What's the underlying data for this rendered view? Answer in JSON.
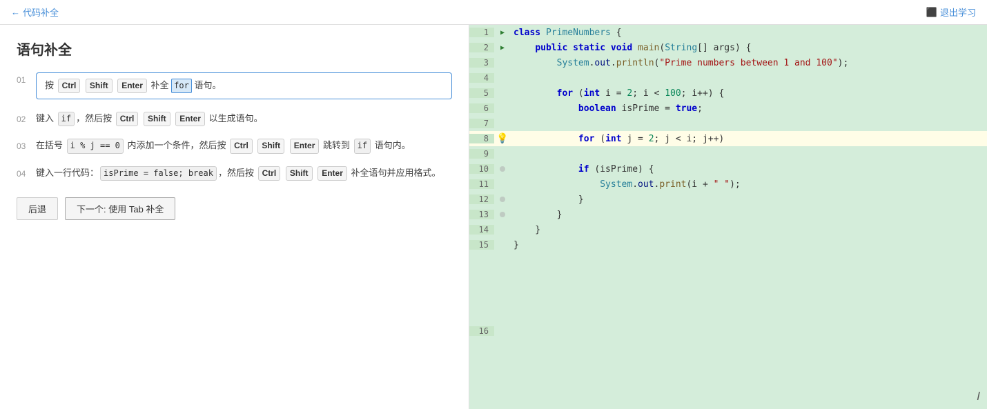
{
  "nav": {
    "back_icon": "←",
    "back_label": "代码补全",
    "exit_icon": "⬛",
    "exit_label": "退出学习"
  },
  "left_panel": {
    "title": "语句补全",
    "steps": [
      {
        "number": "01",
        "active": true,
        "parts": [
          {
            "type": "text",
            "value": "按 "
          },
          {
            "type": "key",
            "value": "Ctrl"
          },
          {
            "type": "text",
            "value": " "
          },
          {
            "type": "key",
            "value": "Shift"
          },
          {
            "type": "text",
            "value": " "
          },
          {
            "type": "key",
            "value": "Enter"
          },
          {
            "type": "text",
            "value": " 补全 "
          },
          {
            "type": "highlight",
            "value": "for"
          },
          {
            "type": "text",
            "value": " 语句。"
          }
        ]
      },
      {
        "number": "02",
        "active": false,
        "parts": [
          {
            "type": "text",
            "value": "键入 "
          },
          {
            "type": "code",
            "value": "if"
          },
          {
            "type": "text",
            "value": "，然后按 "
          },
          {
            "type": "key",
            "value": "Ctrl"
          },
          {
            "type": "text",
            "value": " "
          },
          {
            "type": "key",
            "value": "Shift"
          },
          {
            "type": "text",
            "value": " "
          },
          {
            "type": "key",
            "value": "Enter"
          },
          {
            "type": "text",
            "value": " 以生成语句。"
          }
        ]
      },
      {
        "number": "03",
        "active": false,
        "parts": [
          {
            "type": "text",
            "value": "在括号 "
          },
          {
            "type": "code",
            "value": "i % j == 0"
          },
          {
            "type": "text",
            "value": " 内添加一个条件，然后按 "
          },
          {
            "type": "key",
            "value": "Ctrl"
          },
          {
            "type": "text",
            "value": " "
          },
          {
            "type": "key",
            "value": "Shift"
          },
          {
            "type": "text",
            "value": " "
          },
          {
            "type": "key",
            "value": "Enter"
          },
          {
            "type": "text",
            "value": " 跳转到 "
          },
          {
            "type": "code",
            "value": "if"
          },
          {
            "type": "text",
            "value": " 语句内。"
          }
        ]
      },
      {
        "number": "04",
        "active": false,
        "parts": [
          {
            "type": "text",
            "value": "键入一行代码："
          },
          {
            "type": "code",
            "value": "isPrime = false; break"
          },
          {
            "type": "text",
            "value": "，然后按 "
          },
          {
            "type": "key",
            "value": "Ctrl"
          },
          {
            "type": "text",
            "value": " "
          },
          {
            "type": "key",
            "value": "Shift"
          },
          {
            "type": "text",
            "value": " "
          },
          {
            "type": "key",
            "value": "Enter"
          },
          {
            "type": "text",
            "value": " 补全语句并应用格式。"
          }
        ]
      }
    ],
    "buttons": {
      "back": "后退",
      "next": "下一个: 使用 Tab 补全"
    }
  },
  "code_editor": {
    "lines": [
      {
        "number": 1,
        "indicator": "play",
        "content": "class PrimeNumbers {",
        "highlighted": false
      },
      {
        "number": 2,
        "indicator": "play",
        "content": "    public static void main(String[] args) {",
        "highlighted": false
      },
      {
        "number": 3,
        "indicator": "none",
        "content": "        System.out.println(\"Prime numbers between 1 and 100\");",
        "highlighted": false
      },
      {
        "number": 4,
        "indicator": "none",
        "content": "",
        "highlighted": false
      },
      {
        "number": 5,
        "indicator": "none",
        "content": "        for (int i = 2; i < 100; i++) {",
        "highlighted": false
      },
      {
        "number": 6,
        "indicator": "none",
        "content": "            boolean isPrime = true;",
        "highlighted": false
      },
      {
        "number": 7,
        "indicator": "none",
        "content": "",
        "highlighted": false
      },
      {
        "number": 8,
        "indicator": "bulb",
        "content": "            for (int j = 2; j < i; j++)",
        "highlighted": true
      },
      {
        "number": 9,
        "indicator": "none",
        "content": "",
        "highlighted": false
      },
      {
        "number": 10,
        "indicator": "dot",
        "content": "            if (isPrime) {",
        "highlighted": false
      },
      {
        "number": 11,
        "indicator": "none",
        "content": "                System.out.print(i + \" \");",
        "highlighted": false
      },
      {
        "number": 12,
        "indicator": "dot",
        "content": "            }",
        "highlighted": false
      },
      {
        "number": 13,
        "indicator": "dot",
        "content": "        }",
        "highlighted": false
      },
      {
        "number": 14,
        "indicator": "none",
        "content": "    }",
        "highlighted": false
      },
      {
        "number": 15,
        "indicator": "none",
        "content": "}",
        "highlighted": false
      },
      {
        "number": 16,
        "indicator": "none",
        "content": "",
        "highlighted": false
      }
    ]
  }
}
